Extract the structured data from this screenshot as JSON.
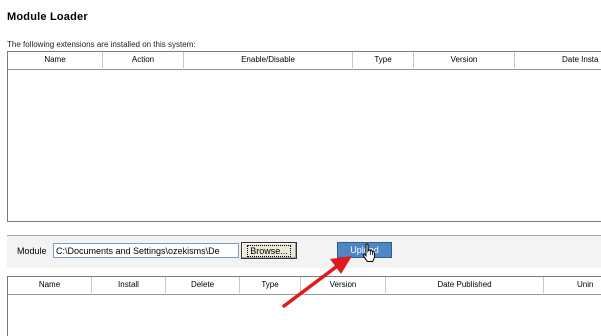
{
  "page": {
    "title": "Module Loader",
    "intro": "The following extensions are installed on this system:"
  },
  "installed_table": {
    "columns": [
      "Name",
      "Action",
      "Enable/Disable",
      "Type",
      "Version",
      "Date Insta"
    ]
  },
  "upload": {
    "module_label": "Module",
    "file_path": "C:\\Documents and Settings\\ozekisms\\De",
    "browse_label": "Browse...",
    "upload_label": "Upload"
  },
  "upload_table": {
    "columns": [
      "Name",
      "Install",
      "Delete",
      "Type",
      "Version",
      "Date Published",
      "Unin"
    ]
  },
  "colors": {
    "upload_button": "#4f86c6",
    "annotation_arrow": "#e01b1b"
  },
  "icons": {
    "cursor": "hand-pointer-icon",
    "annotation": "red-arrow-icon"
  }
}
